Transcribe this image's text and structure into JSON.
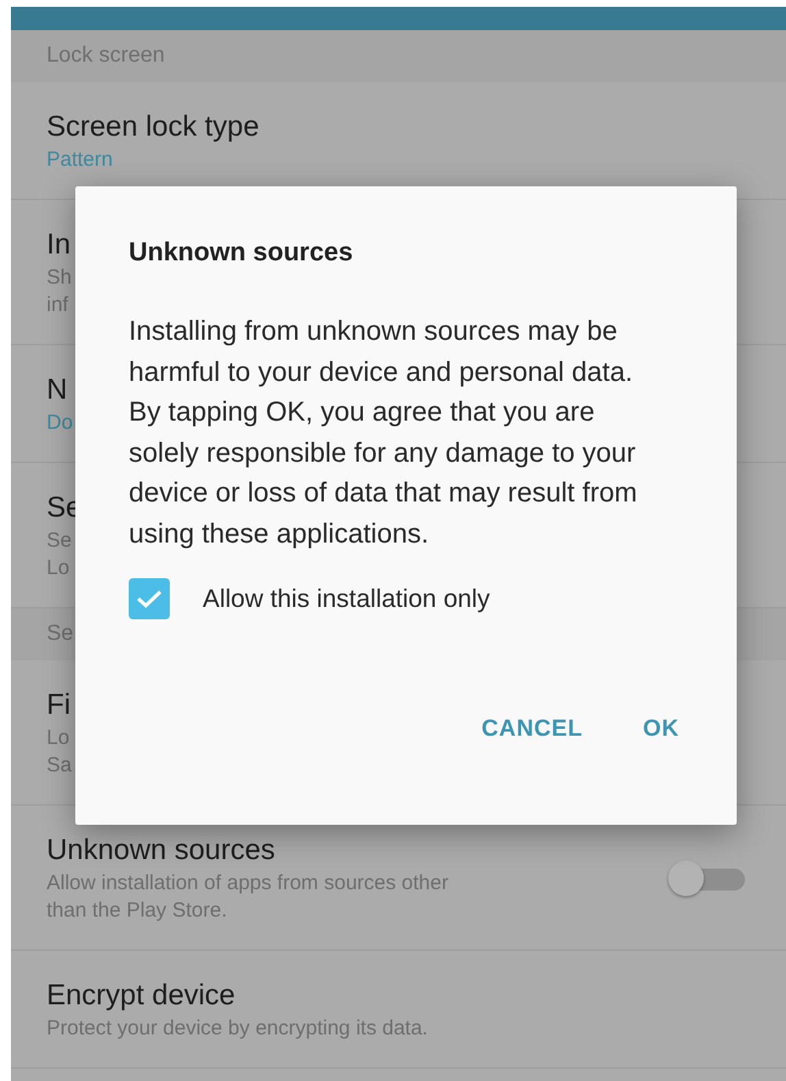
{
  "settings": [
    {
      "kind": "section",
      "title": "Lock screen"
    },
    {
      "kind": "item",
      "title": "Screen lock type",
      "summary": [
        "Pattern"
      ],
      "accent": true
    },
    {
      "kind": "item",
      "title": "In",
      "summary": [
        "Sh",
        "inf"
      ],
      "accent": false
    },
    {
      "kind": "item",
      "title": "N",
      "summary": [
        "Do"
      ],
      "accent": true
    },
    {
      "kind": "item",
      "title": "Se",
      "summary": [
        "Se",
        "Lo"
      ],
      "accent": false
    },
    {
      "kind": "section",
      "title": "Se"
    },
    {
      "kind": "item",
      "title": "Fi",
      "summary": [
        "Lo",
        "Sa"
      ],
      "accent": false
    },
    {
      "kind": "toggle",
      "title": "Unknown sources",
      "summary": [
        "Allow installation of apps from sources other",
        "than the Play Store."
      ],
      "accent": false,
      "on": false
    },
    {
      "kind": "item",
      "title": "Encrypt device",
      "summary": [
        "Protect your device by encrypting its data."
      ],
      "accent": false
    }
  ],
  "dialog": {
    "title": "Unknown sources",
    "message": "Installing from unknown sources may be harmful to your device and personal data. By tapping OK, you agree that you are solely responsible for any damage to your device or loss of data that may result from using these applications.",
    "checkbox": {
      "label": "Allow this installation only",
      "checked": true
    },
    "buttons": [
      "CANCEL",
      "OK"
    ]
  }
}
